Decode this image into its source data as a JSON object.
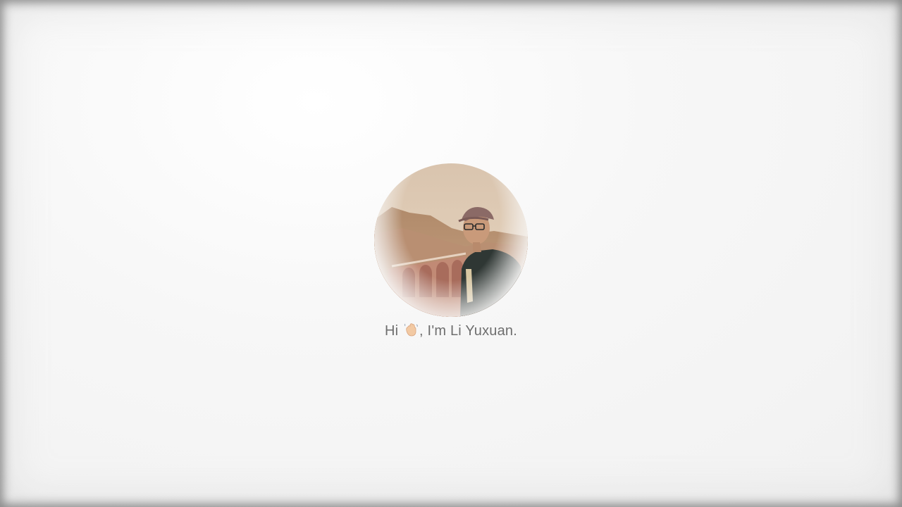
{
  "profile": {
    "avatar_icon": "portrait-photo",
    "greeting_prefix": "Hi",
    "wave_icon": "waving-hand-icon",
    "greeting_suffix": ", I'm Li Yuxuan."
  },
  "colors": {
    "background": "#f4f4f4",
    "text": "#6e6e6e"
  }
}
